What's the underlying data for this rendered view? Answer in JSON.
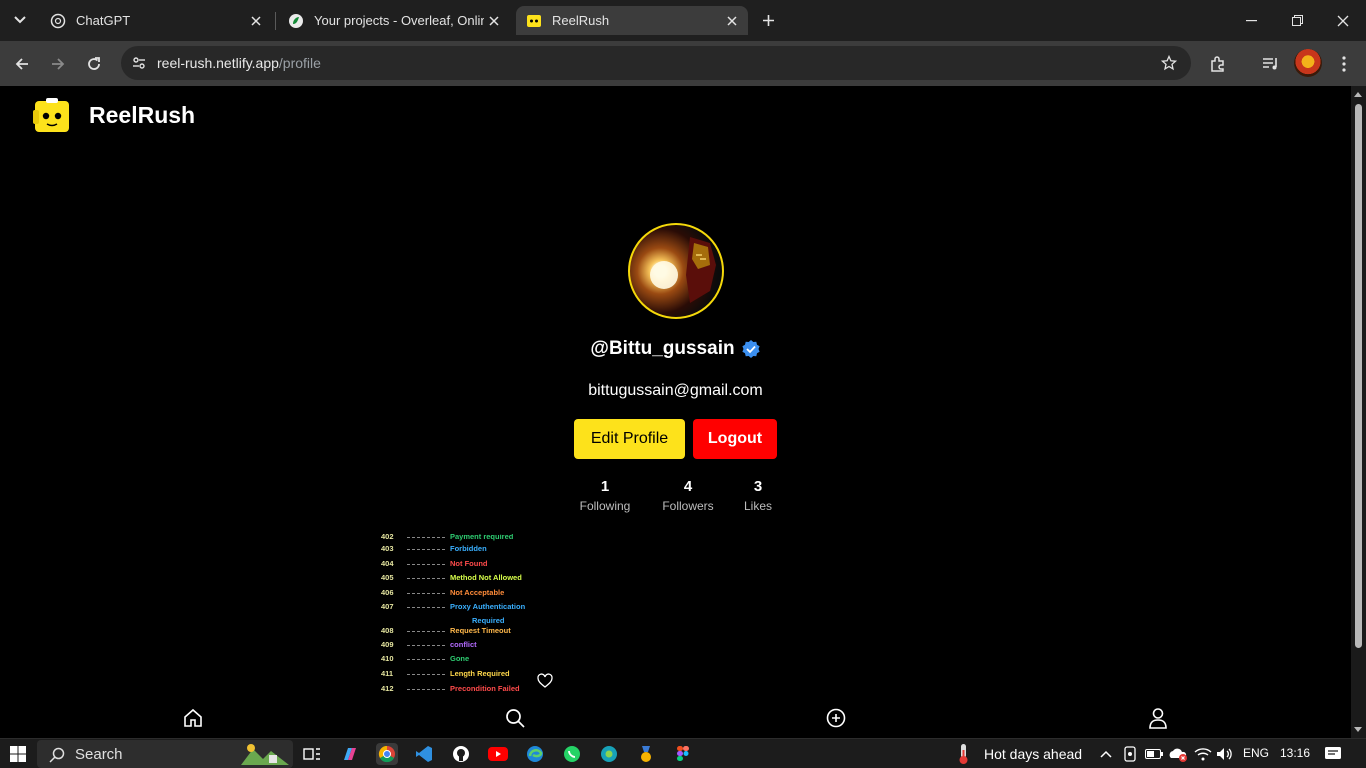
{
  "browser": {
    "tabs": [
      {
        "title": "ChatGPT",
        "icon": "chatgpt-icon",
        "active": false
      },
      {
        "title": "Your projects - Overleaf, Online",
        "icon": "overleaf-icon",
        "active": false
      },
      {
        "title": "ReelRush",
        "icon": "reelrush-icon",
        "active": true
      }
    ],
    "url_host": "reel-rush.netlify.app",
    "url_path": "/profile"
  },
  "app": {
    "brand": "ReelRush",
    "brand_color": "#fde21b"
  },
  "profile": {
    "username": "@Bittu_gussain",
    "verified": true,
    "email": "bittugussain@gmail.com",
    "edit_label": "Edit Profile",
    "logout_label": "Logout",
    "stats": [
      {
        "value": "1",
        "label": "Following"
      },
      {
        "value": "4",
        "label": "Followers"
      },
      {
        "value": "3",
        "label": "Likes"
      }
    ],
    "edit_color": "#fde21b",
    "logout_color": "#ff0000"
  },
  "video_thumb": {
    "rows": [
      {
        "code": "402",
        "desc": "Payment required",
        "color": "#2ecc71"
      },
      {
        "code": "403",
        "desc": "Forbidden",
        "color": "#3ab0ff"
      },
      {
        "code": "404",
        "desc": "Not Found",
        "color": "#ff4b4b"
      },
      {
        "code": "405",
        "desc": "Method Not Allowed",
        "color": "#d8ff4b"
      },
      {
        "code": "406",
        "desc": "Not Acceptable",
        "color": "#ff8c3a"
      },
      {
        "code": "407",
        "desc": "Proxy Authentication",
        "color": "#3ab0ff"
      },
      {
        "code": "",
        "desc": "Required",
        "color": "#3ab0ff"
      },
      {
        "code": "408",
        "desc": "Request Timeout",
        "color": "#ffb84b"
      },
      {
        "code": "409",
        "desc": "conflict",
        "color": "#b46bff"
      },
      {
        "code": "410",
        "desc": "Gone",
        "color": "#2ecc71"
      },
      {
        "code": "411",
        "desc": "Length Required",
        "color": "#ffd84b"
      },
      {
        "code": "412",
        "desc": "Precondition Failed",
        "color": "#ff4b4b"
      }
    ]
  },
  "bottom_nav": [
    "home-icon",
    "search-icon",
    "add-icon",
    "profile-icon"
  ],
  "taskbar": {
    "search_placeholder": "Search",
    "weather": "Hot days ahead",
    "language": "ENG",
    "time": "13:16"
  }
}
